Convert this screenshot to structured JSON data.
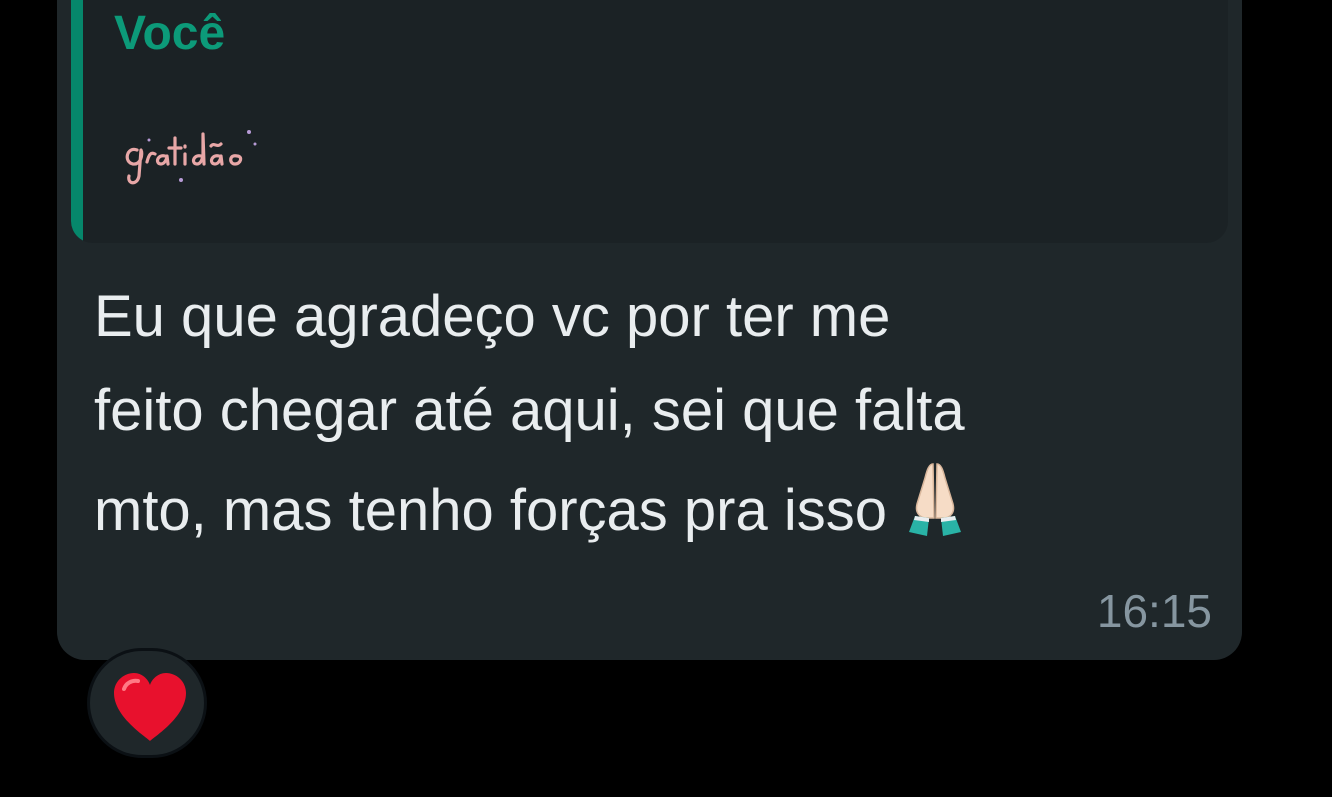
{
  "quoted_message": {
    "author": "Você",
    "sticker_text": "gratidão",
    "sticker_icon": "gratidao-sticker-icon"
  },
  "message": {
    "line1": "Eu que agradeço vc por ter me",
    "line2": "feito chegar até aqui, sei que falta",
    "line3": "mto, mas tenho forças pra isso",
    "emoji_icon": "folded-hands-icon",
    "time": "16:15"
  },
  "reaction": {
    "icon": "red-heart-icon"
  },
  "colors": {
    "background": "#000000",
    "bubble": "#1f272a",
    "quote_bg": "#1b2225",
    "accent": "#06876b",
    "author": "#0c9a79",
    "text": "#e9edef",
    "timestamp": "#8696a0",
    "heart": "#e8112d"
  }
}
